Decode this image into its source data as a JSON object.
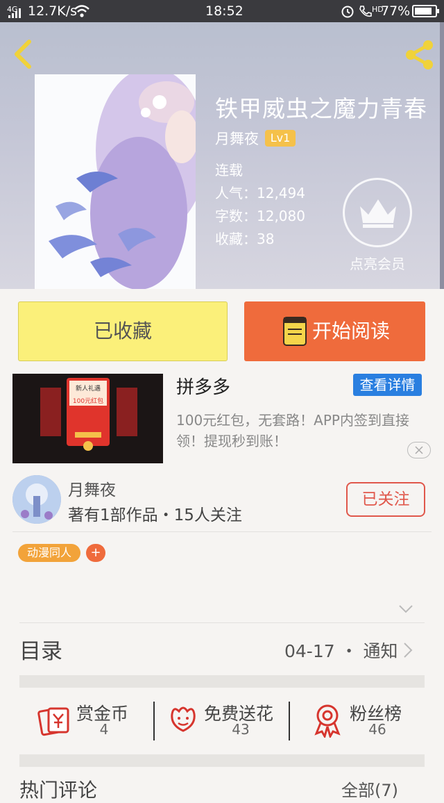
{
  "status_bar": {
    "network": "4G",
    "speed": "12.7K/s",
    "time": "18:52",
    "hd": "HD",
    "battery": "77%"
  },
  "header": {
    "back_icon": "chevron-left-icon",
    "share_icon": "share-icon"
  },
  "book": {
    "title": "铁甲威虫之魔力青春",
    "author": "月舞夜",
    "level": "Lv1",
    "status": "连载",
    "popularity": "人气：12,494",
    "word_count": "字数：12,080",
    "favorites": "收藏：38"
  },
  "vip": {
    "label": "点亮会员",
    "icon": "crown-icon"
  },
  "actions": {
    "collected_label": "已收藏",
    "read_label": "开始阅读",
    "read_icon": "book-icon"
  },
  "ad": {
    "title": "拼多多",
    "detail_button": "查看详情",
    "description": "100元红包，无套路！APP内签到直接领！提现秒到账！",
    "close_icon": "close-icon",
    "banner_text_1": "新人礼遇",
    "banner_text_2": "100元红包"
  },
  "author_card": {
    "name": "月舞夜",
    "stats": "著有1部作品・15人关注",
    "follow_label": "已关注"
  },
  "tags": {
    "items": [
      "动漫同人"
    ],
    "add_label": "+"
  },
  "toc": {
    "label": "目录",
    "date": "04-17 ・ 通知"
  },
  "stats": [
    {
      "label": "赏金币",
      "value": "4",
      "icon": "reward-coin-icon"
    },
    {
      "label": "免费送花",
      "value": "43",
      "icon": "flower-icon"
    },
    {
      "label": "粉丝榜",
      "value": "46",
      "icon": "medal-icon"
    }
  ],
  "comments": {
    "label": "热门评论",
    "all_label": "全部(7)"
  },
  "colors": {
    "accent_orange": "#ef6b3c",
    "collected_yellow": "#fbf07a",
    "follow_red": "#e0574b",
    "ad_blue": "#2a7fe0",
    "tag_orange": "#f2a33a"
  }
}
